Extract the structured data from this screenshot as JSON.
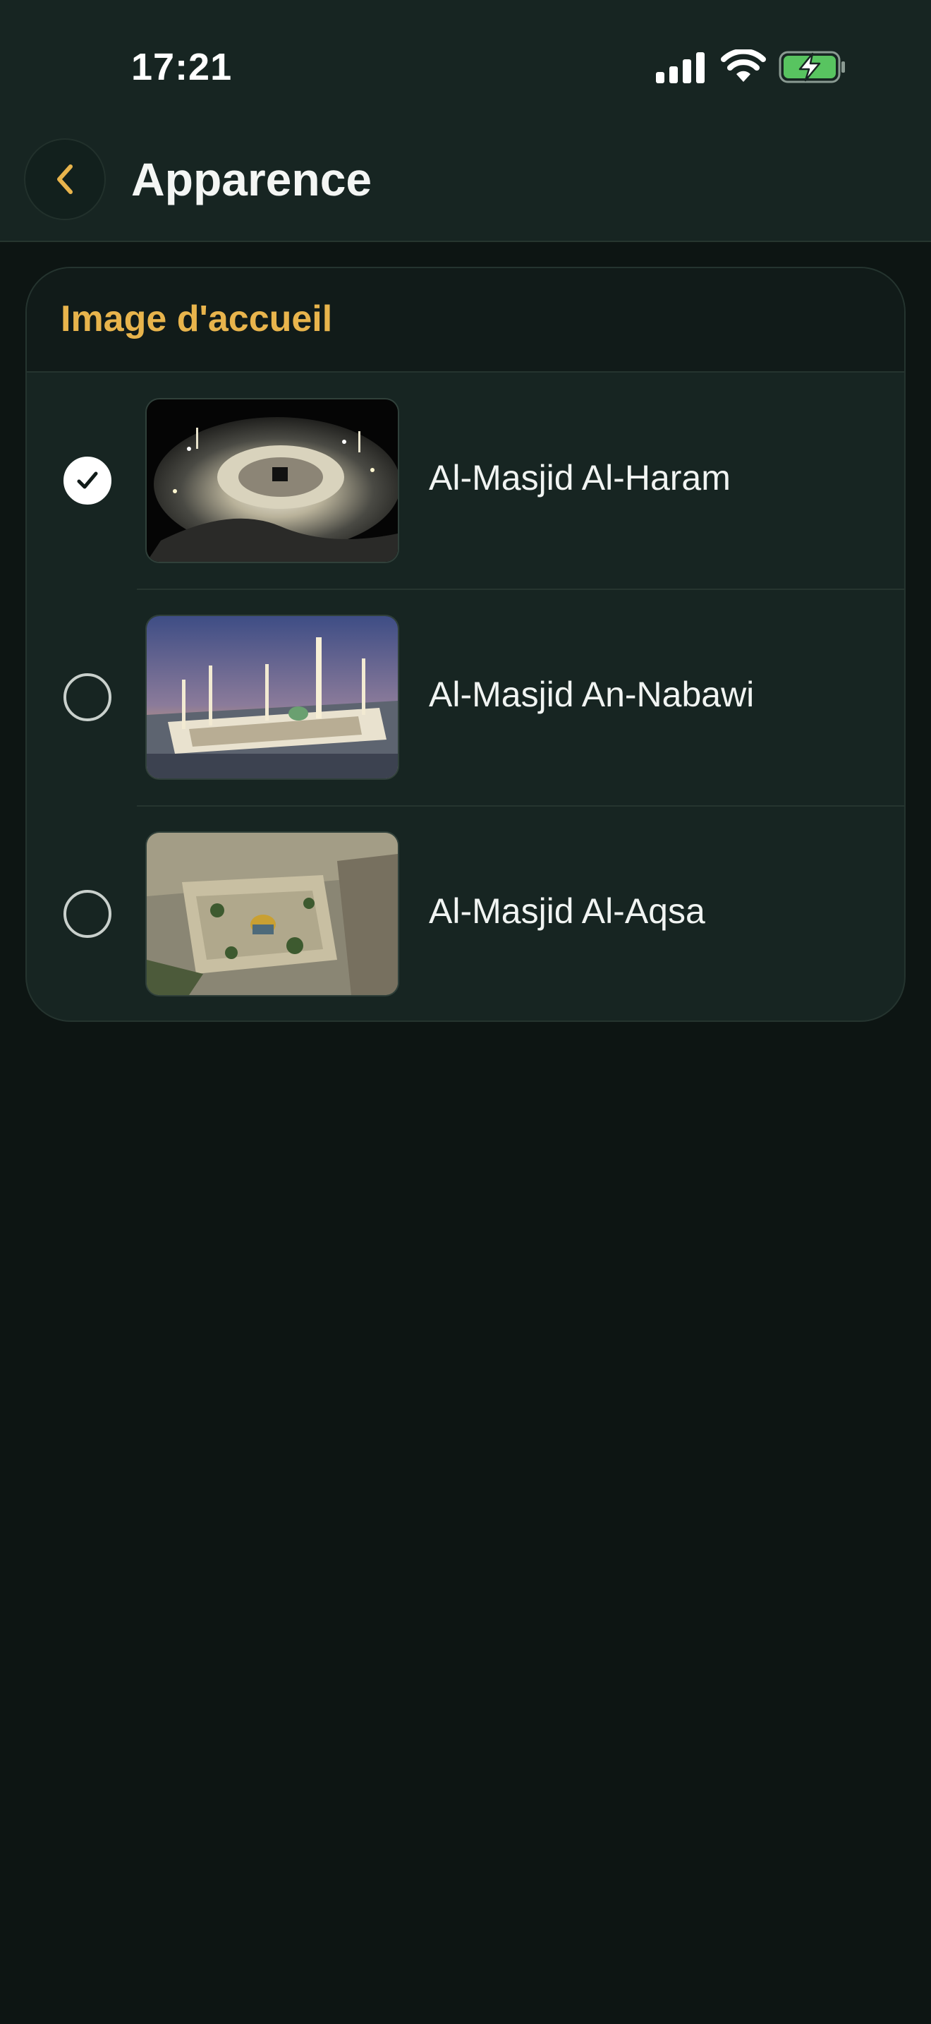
{
  "status_bar": {
    "time": "17:21",
    "icons": [
      "signal-icon",
      "wifi-icon",
      "battery-charging-icon"
    ]
  },
  "nav": {
    "back_icon": "chevron-left-icon",
    "title": "Apparence"
  },
  "section": {
    "title": "Image d'accueil",
    "options": [
      {
        "label": "Al-Masjid Al-Haram",
        "selected": true,
        "thumbnail": "masjid-al-haram-night-aerial"
      },
      {
        "label": "Al-Masjid An-Nabawi",
        "selected": false,
        "thumbnail": "masjid-an-nabawi-dusk"
      },
      {
        "label": "Al-Masjid Al-Aqsa",
        "selected": false,
        "thumbnail": "masjid-al-aqsa-aerial"
      }
    ]
  },
  "colors": {
    "background": "#0d1513",
    "surface": "#172522",
    "accent": "#e8b44c",
    "battery": "#58c460"
  }
}
